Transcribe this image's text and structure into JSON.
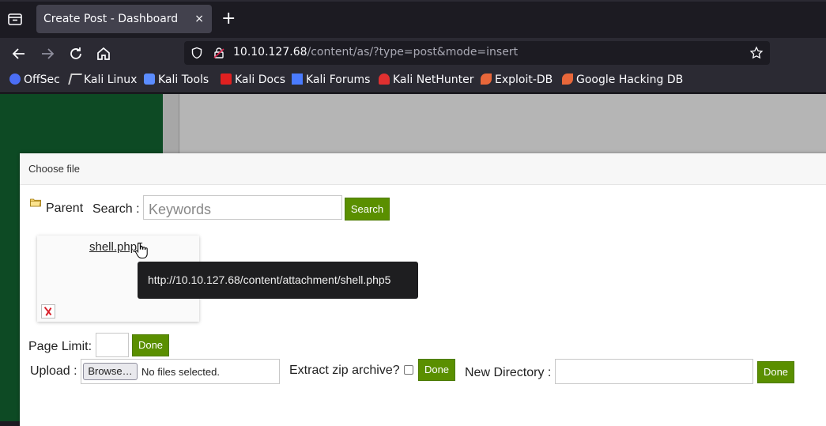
{
  "browser": {
    "tab_title": "Create Post - Dashboard",
    "tab_close": "×",
    "new_tab": "+",
    "url_host": "10.10.127.68",
    "url_path": "/content/as/?type=post&mode=insert",
    "icons": [
      "tab-list-icon",
      "back-icon",
      "forward-icon",
      "reload-icon",
      "home-icon",
      "shield-icon",
      "lock-icon",
      "star-icon"
    ]
  },
  "bookmarks": [
    {
      "label": "OffSec",
      "icon": "offsec-icon",
      "color": "#4b6ef5"
    },
    {
      "label": "Kali Linux",
      "icon": "kali-dragon-icon",
      "color": "#d0d0d0"
    },
    {
      "label": "Kali Tools",
      "icon": "kali-tools-icon",
      "color": "#5b8cff"
    },
    {
      "label": "Kali Docs",
      "icon": "kali-docs-icon",
      "color": "#e02020"
    },
    {
      "label": "Kali Forums",
      "icon": "kali-forums-icon",
      "color": "#4a7bff"
    },
    {
      "label": "Kali NetHunter",
      "icon": "nethunter-icon",
      "color": "#e03030"
    },
    {
      "label": "Exploit-DB",
      "icon": "exploit-db-icon",
      "color": "#e8673a"
    },
    {
      "label": "Google Hacking DB",
      "icon": "ghdb-icon",
      "color": "#e8673a"
    }
  ],
  "dialog": {
    "title": "Choose file",
    "parent_label": "Parent",
    "search_label": "Search :",
    "search_placeholder": "Keywords",
    "search_button": "Search",
    "file_name": "shell.php5",
    "tooltip": "http://10.10.127.68/content/attachment/shell.php5",
    "page_limit_label": "Page Limit:",
    "page_limit_value": "",
    "done_label": "Done",
    "upload_label": "Upload :",
    "browse_label": "Browse…",
    "no_files": "No files selected.",
    "extract_label": "Extract zip archive?",
    "new_directory_label": "New Directory :",
    "new_directory_value": ""
  },
  "colors": {
    "accent_green": "#5a8f00",
    "sidebar_green": "#0d4a24"
  }
}
